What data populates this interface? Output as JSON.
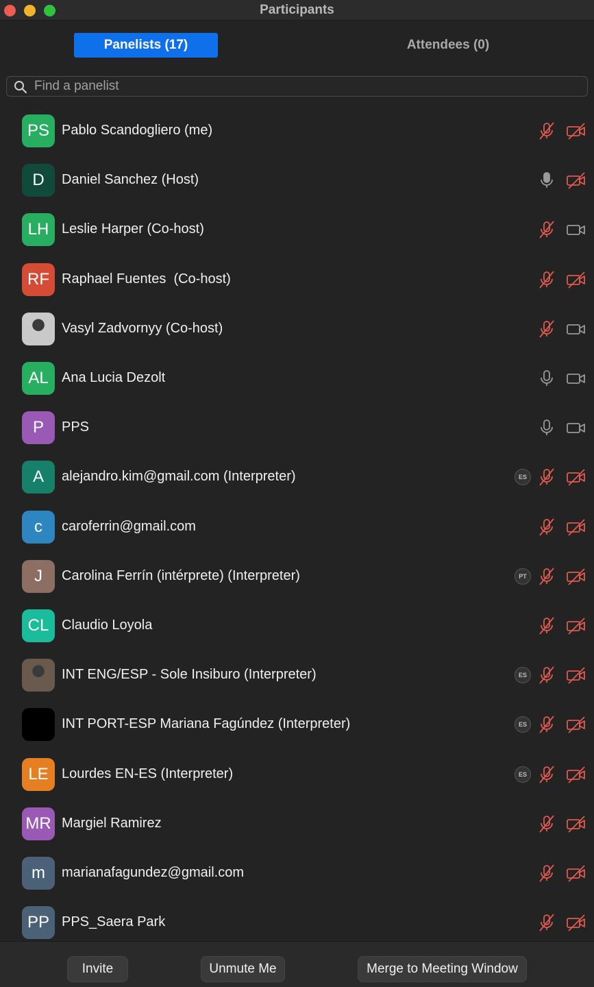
{
  "window": {
    "title": "Participants"
  },
  "tabs": {
    "panelists": "Panelists (17)",
    "attendees": "Attendees (0)"
  },
  "search": {
    "placeholder": "Find a panelist"
  },
  "colors": {
    "accent": "#0e71eb",
    "muted_red": "#e05a4f",
    "icon_gray": "#9a9a9a"
  },
  "participants": [
    {
      "initials": "PS",
      "name": "Pablo Scandogliero (me)",
      "avatar_color": "#27ae60",
      "mic": "muted",
      "video": "off",
      "lang": ""
    },
    {
      "initials": "D",
      "name": "Daniel Sanchez (Host)",
      "avatar_color": "#0f4a3a",
      "mic": "active",
      "video": "off",
      "lang": ""
    },
    {
      "initials": "LH",
      "name": "Leslie Harper (Co-host)",
      "avatar_color": "#27ae60",
      "mic": "muted",
      "video": "on",
      "lang": ""
    },
    {
      "initials": "RF",
      "name": "Raphael Fuentes  (Co-host)",
      "avatar_color": "#d44b36",
      "mic": "muted",
      "video": "off",
      "lang": ""
    },
    {
      "initials": "",
      "name": "Vasyl Zadvornyy (Co-host)",
      "avatar_color": "#c9c9c9",
      "photo": true,
      "mic": "muted",
      "video": "on",
      "lang": ""
    },
    {
      "initials": "AL",
      "name": "Ana Lucia Dezolt",
      "avatar_color": "#27ae60",
      "mic": "unmuted",
      "video": "on",
      "lang": ""
    },
    {
      "initials": "P",
      "name": "PPS",
      "avatar_color": "#9b59b6",
      "mic": "unmuted",
      "video": "on",
      "lang": ""
    },
    {
      "initials": "A",
      "name": "alejandro.kim@gmail.com (Interpreter)",
      "avatar_color": "#16806b",
      "mic": "muted",
      "video": "off",
      "lang": "ES"
    },
    {
      "initials": "c",
      "name": "caroferrin@gmail.com",
      "avatar_color": "#2e86c1",
      "mic": "muted",
      "video": "off",
      "lang": ""
    },
    {
      "initials": "J",
      "name": "Carolina Ferrín (intérprete) (Interpreter)",
      "avatar_color": "#8d6e63",
      "mic": "muted",
      "video": "off",
      "lang": "PT"
    },
    {
      "initials": "CL",
      "name": "Claudio Loyola",
      "avatar_color": "#1abc9c",
      "mic": "muted",
      "video": "off",
      "lang": ""
    },
    {
      "initials": "",
      "name": "INT ENG/ESP - Sole Insiburo (Interpreter)",
      "avatar_color": "#6a5a4e",
      "photo": true,
      "mic": "muted",
      "video": "off",
      "lang": "ES"
    },
    {
      "initials": "",
      "name": "INT PORT-ESP Mariana Fagúndez (Interpreter)",
      "avatar_color": "#000000",
      "mic": "muted",
      "video": "off",
      "lang": "ES"
    },
    {
      "initials": "LE",
      "name": "Lourdes EN-ES (Interpreter)",
      "avatar_color": "#e67e22",
      "mic": "muted",
      "video": "off",
      "lang": "ES"
    },
    {
      "initials": "MR",
      "name": "Margiel Ramirez",
      "avatar_color": "#9b59b6",
      "mic": "muted",
      "video": "off",
      "lang": ""
    },
    {
      "initials": "m",
      "name": "marianafagundez@gmail.com",
      "avatar_color": "#4a6178",
      "mic": "muted",
      "video": "off",
      "lang": ""
    },
    {
      "initials": "PP",
      "name": "PPS_Saera Park",
      "avatar_color": "#4a6178",
      "mic": "muted",
      "video": "off",
      "lang": ""
    }
  ],
  "footer": {
    "invite": "Invite",
    "unmute": "Unmute Me",
    "merge": "Merge to Meeting Window"
  }
}
